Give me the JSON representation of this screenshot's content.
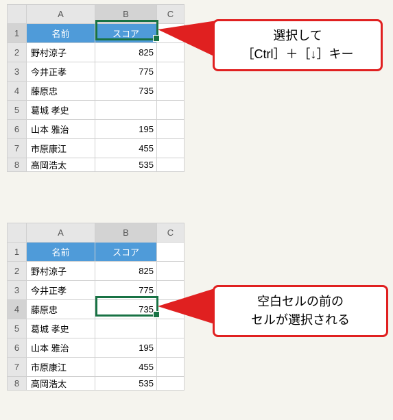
{
  "columns": [
    "A",
    "B",
    "C"
  ],
  "header": {
    "name": "名前",
    "score": "スコア"
  },
  "rows": [
    {
      "n": "野村涼子",
      "s": "825"
    },
    {
      "n": "今井正孝",
      "s": "775"
    },
    {
      "n": "藤原忠",
      "s": "735"
    },
    {
      "n": "葛城 孝史",
      "s": ""
    },
    {
      "n": "山本 雅治",
      "s": "195"
    },
    {
      "n": "市原康江",
      "s": "455"
    },
    {
      "n": "高岡浩太",
      "s": "535"
    }
  ],
  "callout1": {
    "line1": "選択して",
    "line2": "［Ctrl］＋［↓］キー"
  },
  "callout2": {
    "line1": "空白セルの前の",
    "line2": "セルが選択される"
  }
}
